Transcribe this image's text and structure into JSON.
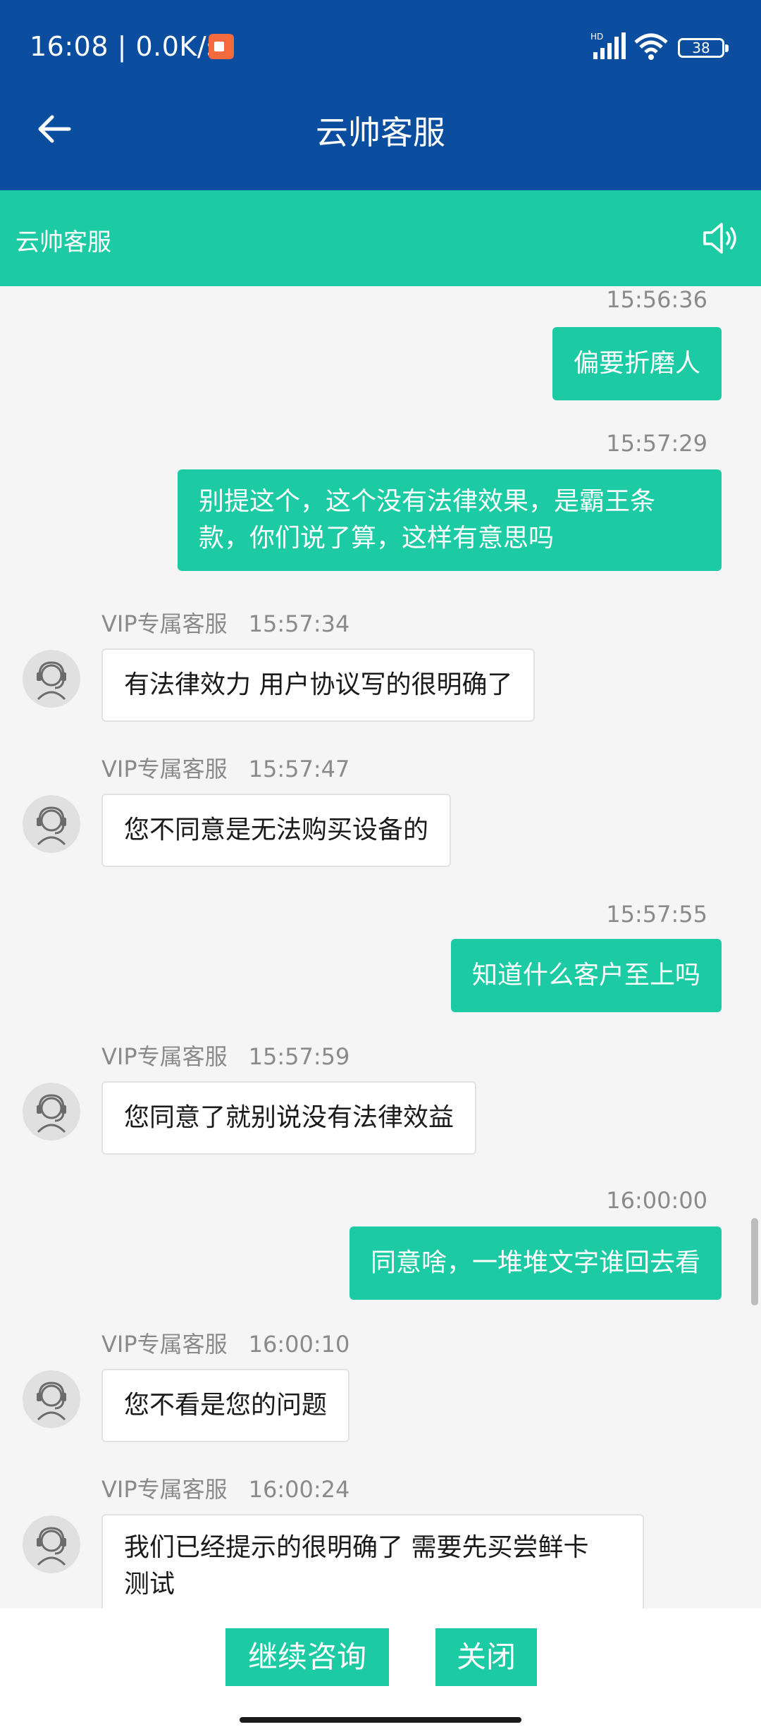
{
  "status_bar": {
    "time_speed": "16:08 | 0.0K/s",
    "battery": "38",
    "network_badge": "HD"
  },
  "app_bar": {
    "title": "云帅客服"
  },
  "sub_header": {
    "title": "云帅客服"
  },
  "messages": [
    {
      "side": "out",
      "time": "15:56:36",
      "text": "偏要折磨人"
    },
    {
      "side": "out",
      "time": "15:57:29",
      "lines": [
        "别提这个，这个没有法律效果，是霸王条",
        "款，你们说了算，这样有意思吗"
      ]
    },
    {
      "side": "in",
      "agent": "VIP专属客服",
      "time": "15:57:34",
      "text": "有法律效力 用户协议写的很明确了"
    },
    {
      "side": "in",
      "agent": "VIP专属客服",
      "time": "15:57:47",
      "text": "您不同意是无法购买设备的"
    },
    {
      "side": "out",
      "time": "15:57:55",
      "text": "知道什么客户至上吗"
    },
    {
      "side": "in",
      "agent": "VIP专属客服",
      "time": "15:57:59",
      "text": "您同意了就别说没有法律效益"
    },
    {
      "side": "out",
      "time": "16:00:00",
      "text": "同意啥，一堆堆文字谁回去看"
    },
    {
      "side": "in",
      "agent": "VIP专属客服",
      "time": "16:00:10",
      "text": "您不看是您的问题"
    },
    {
      "side": "in",
      "agent": "VIP专属客服",
      "time": "16:00:24",
      "lines": [
        "我们已经提示的很明确了 需要先买尝鲜卡",
        "测试"
      ]
    }
  ],
  "actions": {
    "continue_label": "继续咨询",
    "close_label": "关闭"
  },
  "colors": {
    "primary_blue": "#0b4d9e",
    "accent_teal": "#1ccba3"
  },
  "icons": [
    "back-arrow-icon",
    "speaker-icon",
    "agent-headset-icon",
    "signal-icon",
    "wifi-icon",
    "battery-icon",
    "screen-record-icon"
  ]
}
